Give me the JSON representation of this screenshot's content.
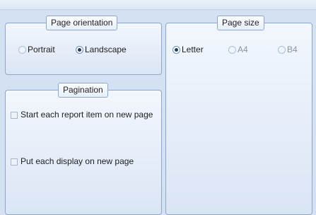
{
  "page_orientation": {
    "title": "Page orientation",
    "options": [
      {
        "label": "Portrait",
        "selected": false
      },
      {
        "label": "Landscape",
        "selected": true
      }
    ]
  },
  "pagination": {
    "title": "Pagination",
    "options": [
      {
        "label": "Start each report item on new page",
        "checked": false
      },
      {
        "label": "Put each display on new page",
        "checked": false
      }
    ]
  },
  "page_size": {
    "title": "Page size",
    "options": [
      {
        "label": "Letter",
        "selected": true
      },
      {
        "label": "A4",
        "selected": false
      },
      {
        "label": "B4",
        "selected": false
      }
    ]
  }
}
